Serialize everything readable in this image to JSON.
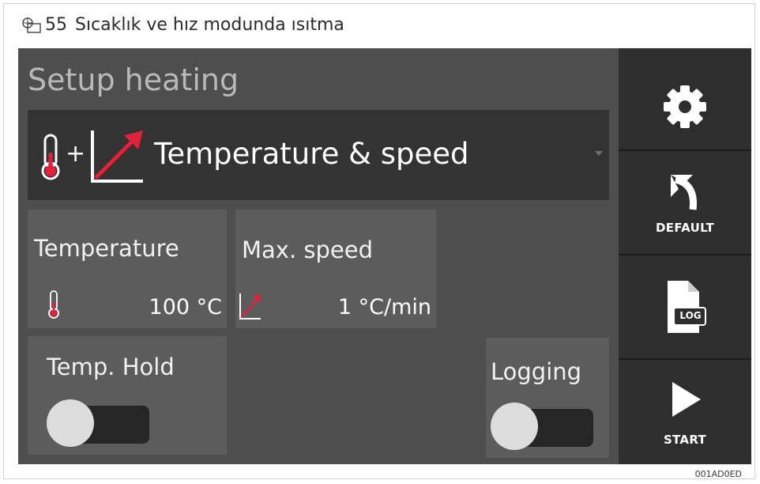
{
  "caption": {
    "number": "55",
    "text": "Sıcaklık ve hız modunda ısıtma",
    "icon": "figure-icon"
  },
  "screen": {
    "title": "Setup heating",
    "mode_select": {
      "selected": "Temperature & speed",
      "icons": [
        "thermometer-icon",
        "speed-ramp-icon"
      ],
      "plus": "+"
    },
    "temperature": {
      "label": "Temperature",
      "value": "100 °C",
      "icon": "thermometer-icon"
    },
    "max_speed": {
      "label": "Max. speed",
      "value": "1 °C/min",
      "icon": "speed-ramp-icon"
    },
    "temp_hold": {
      "label": "Temp. Hold",
      "enabled": false
    },
    "logging": {
      "label": "Logging",
      "enabled": false
    }
  },
  "sidebar": {
    "settings": {
      "icon": "gear-icon"
    },
    "default": {
      "label": "DEFAULT",
      "icon": "undo-arrow-icon"
    },
    "log": {
      "icon": "log-file-icon",
      "badge": "LOG"
    },
    "start": {
      "label": "START",
      "icon": "play-icon"
    }
  },
  "image_code": "001AD0ED",
  "colors": {
    "accent": "#e2213c",
    "panel_bg": "#4e4e4e",
    "select_bg": "#333333",
    "tile_bg": "#5c5c5c",
    "sidebar_bg": "#2e2e2e"
  }
}
